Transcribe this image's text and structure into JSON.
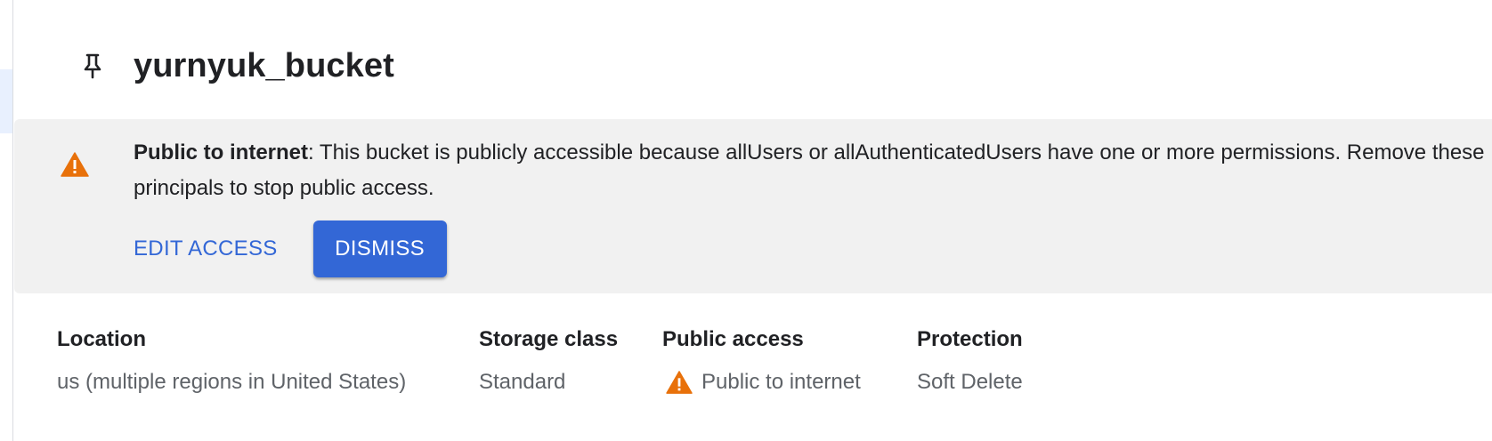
{
  "header": {
    "title": "yurnyuk_bucket",
    "pin_icon": "pin-icon"
  },
  "banner": {
    "icon": "warning-icon",
    "icon_color": "#e8710a",
    "bold_text": "Public to internet",
    "message": ": This bucket is publicly accessible because allUsers or allAuthenticatedUsers have one or more permissions. Remove these principals to stop public access.",
    "edit_access_label": "EDIT ACCESS",
    "dismiss_label": "DISMISS",
    "accent_color": "#3367d6"
  },
  "properties": {
    "location": {
      "label": "Location",
      "value": "us (multiple regions in United States)"
    },
    "storage_class": {
      "label": "Storage class",
      "value": "Standard"
    },
    "public_access": {
      "label": "Public access",
      "value": "Public to internet",
      "icon": "warning-icon"
    },
    "protection": {
      "label": "Protection",
      "value": "Soft Delete"
    }
  }
}
